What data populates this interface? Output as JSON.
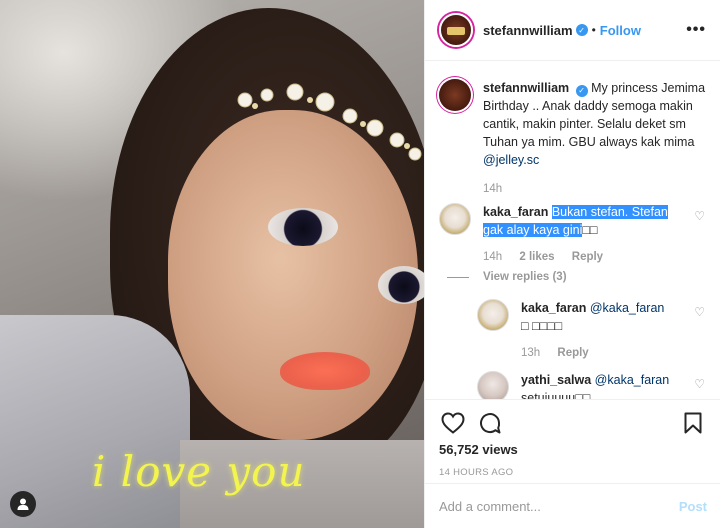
{
  "media": {
    "overlay_text": "i love you"
  },
  "post": {
    "username": "stefannwilliam",
    "follow_label": "Follow",
    "more_label": "•••",
    "dot": "•"
  },
  "comments": [
    {
      "username": "stefannwilliam",
      "text_pre": "My princess Jemima Birthday .. Anak daddy semoga makin cantik, makin pinter. Selalu deket sm Tuhan ya mim. GBU always kak mima ",
      "mention": "@jelley.sc",
      "time": "14h"
    },
    {
      "username": "kaka_faran",
      "text_selected": "Bukan stefan. Stefan gak alay kaya gini",
      "text_tail": "□□",
      "time": "14h",
      "likes": "2 likes",
      "reply": "Reply",
      "view_replies": "View replies (3)"
    },
    {
      "username": "kaka_faran",
      "mention": "@kaka_faran",
      "text_tail": "□ □□□□",
      "time": "13h",
      "reply": "Reply"
    },
    {
      "username": "yathi_salwa",
      "mention": "@kaka_faran",
      "text_tail": "setujuuuu□□"
    }
  ],
  "actions": {
    "views": "56,752 views",
    "time_ago": "14 HOURS AGO"
  },
  "add_comment": {
    "placeholder": "Add a comment...",
    "post_label": "Post"
  },
  "colors": {
    "accent": "#3897f0",
    "selection": "#3390ff",
    "overlay_text": "#f3f54e"
  }
}
